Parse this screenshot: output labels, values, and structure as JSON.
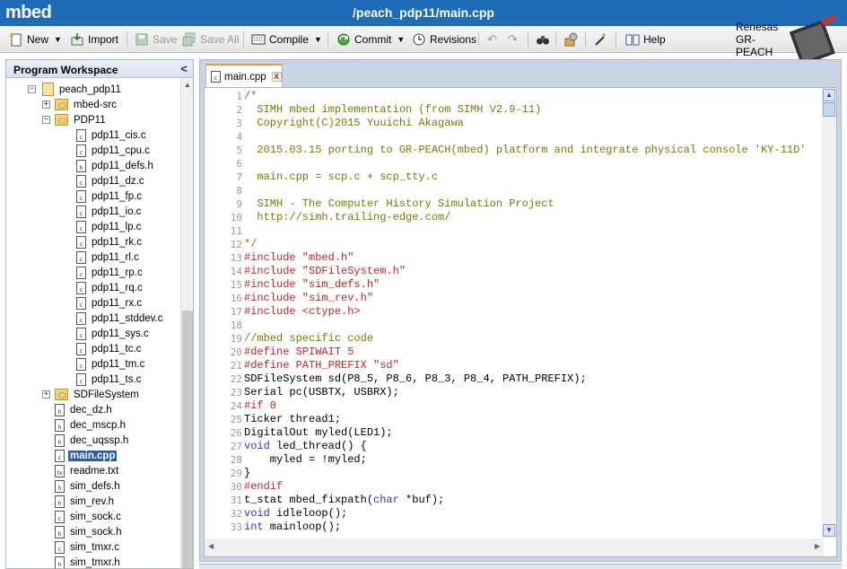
{
  "app": {
    "logo": "mbed",
    "title": "/peach_pdp11/main.cpp"
  },
  "toolbar": {
    "new": "New",
    "import": "Import",
    "save": "Save",
    "save_all": "Save All",
    "compile": "Compile",
    "commit": "Commit",
    "revisions": "Revisions",
    "help": "Help",
    "platform": "Renesas GR-PEACH"
  },
  "sidebar": {
    "title": "Program Workspace",
    "tree": [
      {
        "label": "peach_pdp11",
        "type": "program",
        "toggle": "−",
        "level": 0
      },
      {
        "label": "mbed-src",
        "type": "folder",
        "toggle": "+",
        "level": 1
      },
      {
        "label": "PDP11",
        "type": "folder",
        "toggle": "−",
        "level": 1
      },
      {
        "label": "pdp11_cis.c",
        "type": "c",
        "level": 2
      },
      {
        "label": "pdp11_cpu.c",
        "type": "c",
        "level": 2
      },
      {
        "label": "pdp11_defs.h",
        "type": "h",
        "level": 2
      },
      {
        "label": "pdp11_dz.c",
        "type": "c",
        "level": 2
      },
      {
        "label": "pdp11_fp.c",
        "type": "c",
        "level": 2
      },
      {
        "label": "pdp11_io.c",
        "type": "c",
        "level": 2
      },
      {
        "label": "pdp11_lp.c",
        "type": "c",
        "level": 2
      },
      {
        "label": "pdp11_rk.c",
        "type": "c",
        "level": 2
      },
      {
        "label": "pdp11_rl.c",
        "type": "c",
        "level": 2
      },
      {
        "label": "pdp11_rp.c",
        "type": "c",
        "level": 2
      },
      {
        "label": "pdp11_rq.c",
        "type": "c",
        "level": 2
      },
      {
        "label": "pdp11_rx.c",
        "type": "c",
        "level": 2
      },
      {
        "label": "pdp11_stddev.c",
        "type": "c",
        "level": 2
      },
      {
        "label": "pdp11_sys.c",
        "type": "c",
        "level": 2
      },
      {
        "label": "pdp11_tc.c",
        "type": "c",
        "level": 2
      },
      {
        "label": "pdp11_tm.c",
        "type": "c",
        "level": 2
      },
      {
        "label": "pdp11_ts.c",
        "type": "c",
        "level": 2
      },
      {
        "label": "SDFileSystem",
        "type": "folder",
        "toggle": "+",
        "level": 1
      },
      {
        "label": "dec_dz.h",
        "type": "h",
        "level": 1
      },
      {
        "label": "dec_mscp.h",
        "type": "h",
        "level": 1
      },
      {
        "label": "dec_uqssp.h",
        "type": "h",
        "level": 1
      },
      {
        "label": "main.cpp",
        "type": "c",
        "level": 1,
        "selected": true
      },
      {
        "label": "readme.txt",
        "type": "txt",
        "level": 1
      },
      {
        "label": "sim_defs.h",
        "type": "h",
        "level": 1
      },
      {
        "label": "sim_rev.h",
        "type": "h",
        "level": 1
      },
      {
        "label": "sim_sock.c",
        "type": "c",
        "level": 1
      },
      {
        "label": "sim_sock.h",
        "type": "h",
        "level": 1
      },
      {
        "label": "sim_tmxr.c",
        "type": "c",
        "level": 1
      },
      {
        "label": "sim_tmxr.h",
        "type": "h",
        "level": 1
      }
    ]
  },
  "editor": {
    "tab_label": "main.cpp",
    "lines": [
      {
        "n": "1",
        "t": "/*",
        "k": "comment"
      },
      {
        "n": "2",
        "t": "  SIMH mbed implementation (from SIMH V2.9-11)",
        "k": "comment"
      },
      {
        "n": "3",
        "t": "  Copyright(C)2015 Yuuichi Akagawa",
        "k": "comment"
      },
      {
        "n": "4",
        "t": "",
        "k": "comment"
      },
      {
        "n": "5",
        "t": "  2015.03.15 porting to GR-PEACH(mbed) platform and integrate physical console 'KY-11D'",
        "k": "comment"
      },
      {
        "n": "6",
        "t": "",
        "k": "comment"
      },
      {
        "n": "7",
        "t": "  main.cpp = scp.c + scp_tty.c",
        "k": "comment"
      },
      {
        "n": "8",
        "t": "",
        "k": "comment"
      },
      {
        "n": "9",
        "t": "  SIMH - The Computer History Simulation Project",
        "k": "comment"
      },
      {
        "n": "10",
        "t": "  http://simh.trailing-edge.com/",
        "k": "comment"
      },
      {
        "n": "11",
        "t": "",
        "k": "comment"
      },
      {
        "n": "12",
        "t": "*/",
        "k": "comment"
      },
      {
        "n": "13",
        "t": "#include \"mbed.h\"",
        "k": "pre"
      },
      {
        "n": "14",
        "t": "#include \"SDFileSystem.h\"",
        "k": "pre"
      },
      {
        "n": "15",
        "t": "#include \"sim_defs.h\"",
        "k": "pre"
      },
      {
        "n": "16",
        "t": "#include \"sim_rev.h\"",
        "k": "pre"
      },
      {
        "n": "17",
        "t": "#include <ctype.h>",
        "k": "pre"
      },
      {
        "n": "18",
        "t": "",
        "k": "plain"
      },
      {
        "n": "19",
        "t": "//mbed specific code",
        "k": "comment"
      },
      {
        "n": "20",
        "t": "#define SPIWAIT 5",
        "k": "pre"
      },
      {
        "n": "21",
        "t": "#define PATH_PREFIX \"sd\"",
        "k": "pre"
      },
      {
        "n": "22",
        "t": "SDFileSystem sd(P8_5, P8_6, P8_3, P8_4, PATH_PREFIX);",
        "k": "plain"
      },
      {
        "n": "23",
        "t": "Serial pc(USBTX, USBRX);",
        "k": "plain"
      },
      {
        "n": "24",
        "t": "#if 0",
        "k": "pre"
      },
      {
        "n": "25",
        "t": "Ticker thread1;",
        "k": "plain"
      },
      {
        "n": "26",
        "t": "DigitalOut myled(LED1);",
        "k": "plain"
      },
      {
        "n": "27",
        "kw": "void",
        "t": " led_thread() {",
        "k": "plain"
      },
      {
        "n": "28",
        "t": "    myled = !myled;",
        "k": "plain"
      },
      {
        "n": "29",
        "t": "}",
        "k": "plain"
      },
      {
        "n": "30",
        "t": "#endif",
        "k": "pre"
      },
      {
        "n": "31",
        "t": "t_stat mbed_fixpath(",
        "kw2": "char",
        "t2": " *buf);",
        "k": "plain"
      },
      {
        "n": "32",
        "kw": "void",
        "t": " idleloop();",
        "k": "plain"
      },
      {
        "n": "33",
        "kw": "int",
        "t": " mainloop();",
        "k": "plain"
      }
    ]
  }
}
